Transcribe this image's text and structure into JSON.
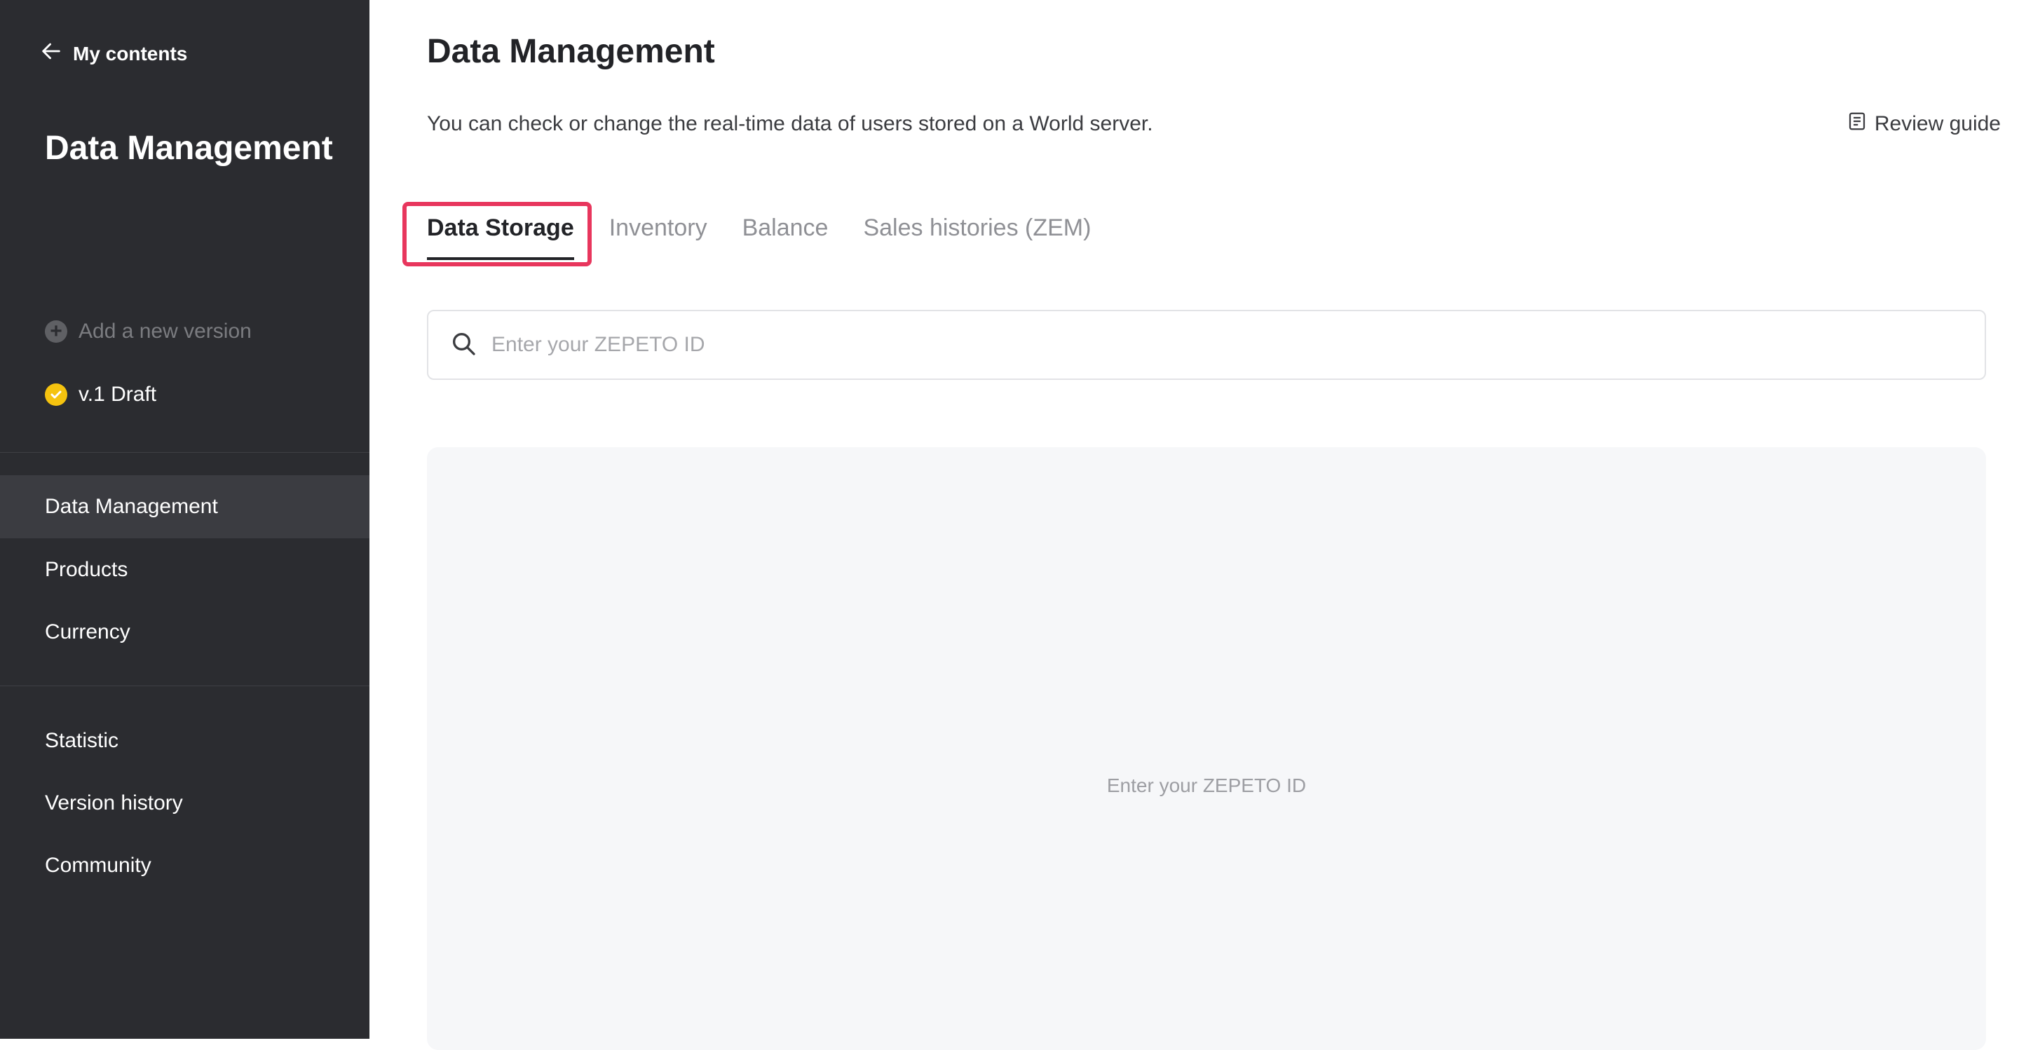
{
  "sidebar": {
    "back_label": "My contents",
    "title": "Data Management",
    "add_version_label": "Add a new version",
    "version_label": "v.1 Draft",
    "nav_group_1": [
      "Data Management",
      "Products",
      "Currency"
    ],
    "nav_group_2": [
      "Statistic",
      "Version history",
      "Community"
    ],
    "active_item": "Data Management"
  },
  "main": {
    "title": "Data Management",
    "subtitle": "You can check or change the real-time data of users stored on a World server.",
    "review_guide_label": "Review guide",
    "tabs": [
      "Data Storage",
      "Inventory",
      "Balance",
      "Sales histories (ZEM)"
    ],
    "active_tab": "Data Storage",
    "search": {
      "placeholder": "Enter your ZEPETO ID",
      "value": ""
    },
    "empty_state_text": "Enter your ZEPETO ID"
  },
  "colors": {
    "sidebar_bg": "#2b2c30",
    "version_badge": "#f5c30f",
    "highlight": "#e8365d",
    "panel_bg": "#f6f7f9"
  }
}
